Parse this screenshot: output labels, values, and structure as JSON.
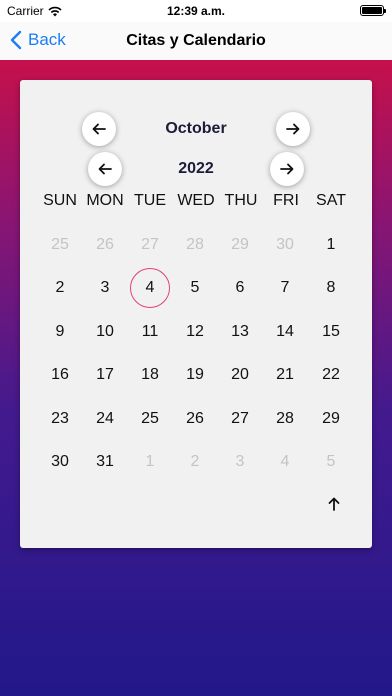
{
  "status": {
    "carrier": "Carrier",
    "time": "12:39 a.m."
  },
  "nav": {
    "back_label": "Back",
    "title": "Citas y Calendario"
  },
  "calendar": {
    "month": "October",
    "year": "2022",
    "weekdays": [
      "SUN",
      "MON",
      "TUE",
      "WED",
      "THU",
      "FRI",
      "SAT"
    ],
    "weeks": [
      [
        "25",
        "26",
        "27",
        "28",
        "29",
        "30",
        "1"
      ],
      [
        "2",
        "3",
        "4",
        "5",
        "6",
        "7",
        "8"
      ],
      [
        "9",
        "10",
        "11",
        "12",
        "13",
        "14",
        "15"
      ],
      [
        "16",
        "17",
        "18",
        "19",
        "20",
        "21",
        "22"
      ],
      [
        "23",
        "24",
        "25",
        "26",
        "27",
        "28",
        "29"
      ],
      [
        "30",
        "31",
        "1",
        "2",
        "3",
        "4",
        "5"
      ]
    ],
    "selected_day": "4"
  },
  "icons": {
    "prev": "arrow-left-icon",
    "next": "arrow-right-icon",
    "scroll_up": "arrow-up-icon",
    "back": "chevron-left-icon"
  },
  "colors": {
    "accent": "#1d7cf2",
    "selected_ring": "#e0436f",
    "gradient_top": "#c6104b",
    "gradient_bottom": "#22188a",
    "card": "#f1f1f1"
  }
}
